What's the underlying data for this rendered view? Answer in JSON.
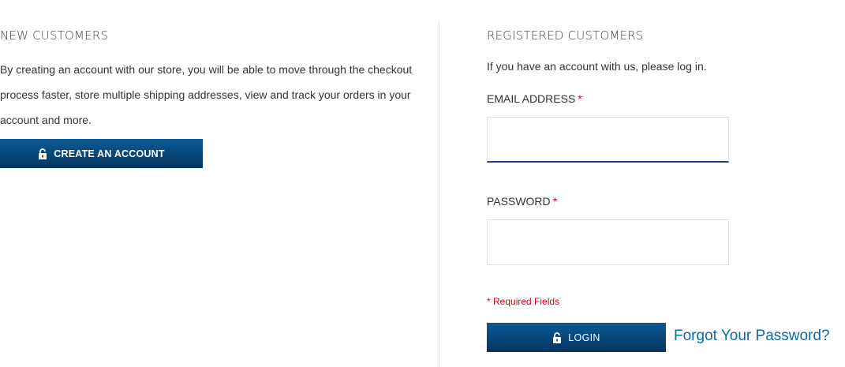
{
  "new_customers": {
    "title": "NEW CUSTOMERS",
    "description": "By creating an account with our store, you will be able to move through the checkout process faster, store multiple shipping addresses, view and track your orders in your account and more.",
    "create_button_label": "CREATE AN ACCOUNT"
  },
  "registered_customers": {
    "title": "REGISTERED CUSTOMERS",
    "intro": "If you have an account with us, please log in.",
    "email_label": "EMAIL ADDRESS",
    "email_value": "",
    "password_label": "PASSWORD",
    "password_value": "",
    "required_marker": "*",
    "required_note": "* Required Fields",
    "login_button_label": "LOGIN",
    "forgot_link": "Forgot Your Password?"
  },
  "colors": {
    "button": "#06355e",
    "link": "#0b6aa8",
    "required": "#d0021b",
    "focus_underline": "#2b3a8c"
  },
  "icons": {
    "create_button_icon": "unlock-icon",
    "login_button_icon": "unlock-icon"
  }
}
